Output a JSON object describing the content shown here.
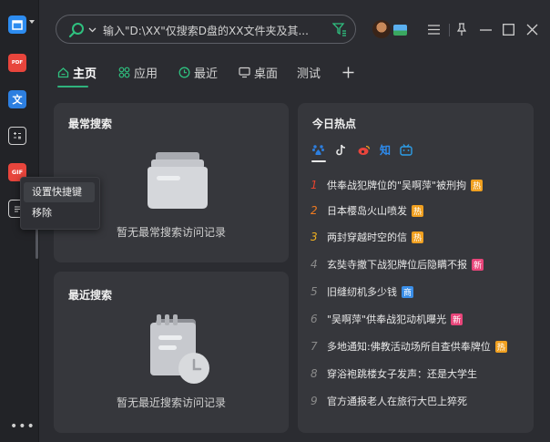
{
  "search": {
    "placeholder": "输入\"D:\\XX\"仅搜索D盘的XX文件夹及其..."
  },
  "tabs": [
    {
      "label": "主页",
      "icon": "home-icon"
    },
    {
      "label": "应用",
      "icon": "apps-icon"
    },
    {
      "label": "最近",
      "icon": "clock-icon"
    },
    {
      "label": "桌面",
      "icon": "monitor-icon"
    },
    {
      "label": "测试"
    }
  ],
  "sidebar": {
    "pdf_label": "PDF",
    "wen_label": "文",
    "gif_label": "GIF"
  },
  "context_menu": {
    "items": [
      "设置快捷键",
      "移除"
    ]
  },
  "frequent": {
    "title": "最常搜索",
    "empty": "暂无最常搜索访问记录"
  },
  "recent": {
    "title": "最近搜索",
    "empty": "暂无最近搜索访问记录"
  },
  "hot": {
    "title": "今日热点",
    "sources": [
      "baidu-icon",
      "douyin-icon",
      "weibo-icon",
      "zhihu-icon",
      "bilibili-icon"
    ],
    "zhihu_label": "知",
    "items": [
      {
        "rank": "1",
        "text": "供奉战犯牌位的\"吴啊萍\"被刑拘",
        "badge": "热",
        "badge_color": "#f0a020",
        "rank_color": "#e8432e"
      },
      {
        "rank": "2",
        "text": "日本樱岛火山喷发",
        "badge": "热",
        "badge_color": "#f0a020",
        "rank_color": "#f07a20"
      },
      {
        "rank": "3",
        "text": "两封穿越时空的信",
        "badge": "热",
        "badge_color": "#f0a020",
        "rank_color": "#f0b020"
      },
      {
        "rank": "4",
        "text": "玄奘寺撤下战犯牌位后隐瞒不报",
        "badge": "新",
        "badge_color": "#e8457a",
        "rank_color": "#8a8a8a"
      },
      {
        "rank": "5",
        "text": "旧缝纫机多少钱",
        "badge": "商",
        "badge_color": "#3a8ee8",
        "rank_color": "#8a8a8a"
      },
      {
        "rank": "6",
        "text": "\"吴啊萍\"供奉战犯动机曝光",
        "badge": "新",
        "badge_color": "#e8457a",
        "rank_color": "#8a8a8a"
      },
      {
        "rank": "7",
        "text": "多地通知:佛教活动场所自查供奉牌位",
        "badge": "热",
        "badge_color": "#f0a020",
        "rank_color": "#8a8a8a"
      },
      {
        "rank": "8",
        "text": "穿浴袍跳楼女子发声：还是大学生",
        "badge": "",
        "badge_color": "",
        "rank_color": "#8a8a8a"
      },
      {
        "rank": "9",
        "text": "官方通报老人在旅行大巴上猝死",
        "badge": "",
        "badge_color": "",
        "rank_color": "#8a8a8a"
      }
    ]
  }
}
